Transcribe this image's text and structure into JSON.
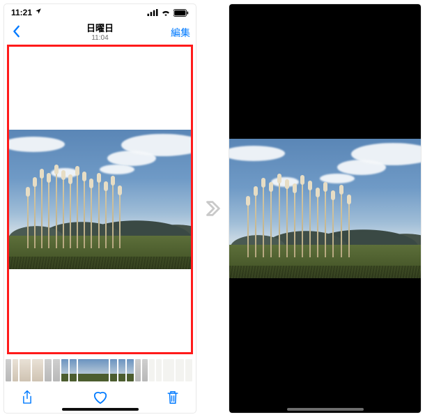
{
  "status": {
    "time": "11:21",
    "location_icon": "location-arrow-icon",
    "signal_icon": "signal-icon",
    "wifi_icon": "wifi-icon",
    "battery_icon": "battery-icon"
  },
  "nav": {
    "back_icon": "chevron-left-icon",
    "title": "日曜日",
    "subtitle": "11:04",
    "edit_label": "編集"
  },
  "toolbar": {
    "share_icon": "share-icon",
    "favorite_icon": "heart-icon",
    "trash_icon": "trash-icon"
  },
  "arrow_icon": "arrow-right-icon",
  "colors": {
    "ios_blue": "#007aff",
    "highlight_red": "#ff1a1a"
  }
}
